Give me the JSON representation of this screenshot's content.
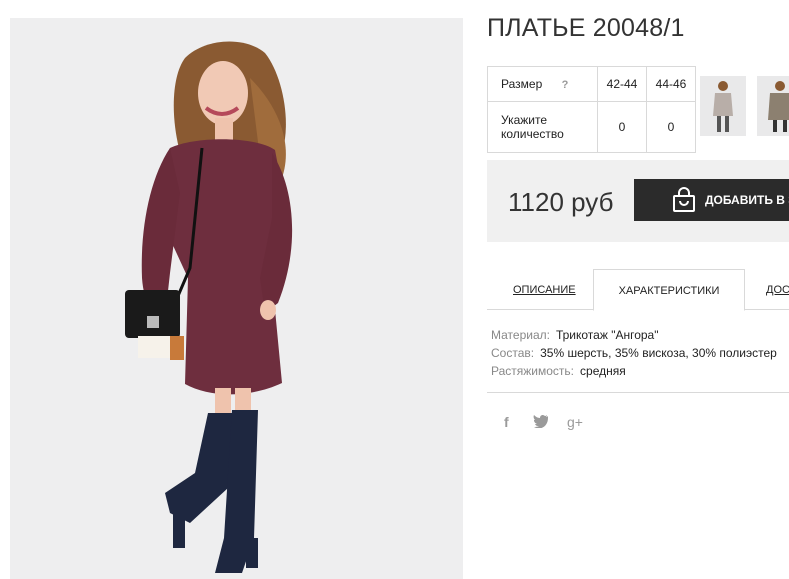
{
  "product": {
    "title": "ПЛАТЬЕ 20048/1"
  },
  "size_table": {
    "size_label": "Размер",
    "help_glyph": "?",
    "sizes": [
      "42-44",
      "44-46"
    ],
    "quantity_label": "Укажите количество",
    "quantities": [
      "0",
      "0"
    ]
  },
  "thumbnails": [
    {
      "icon": "dress-thumbnail",
      "dress_color": "#b8aea8"
    },
    {
      "icon": "dress-thumbnail",
      "dress_color": "#8c8070"
    }
  ],
  "purchase": {
    "price": "1120 руб",
    "add_button_label": "ДОБАВИТЬ В ЗАКАЗ",
    "button_color": "#2b2b2b"
  },
  "tabs": [
    {
      "label": "ОПИСАНИЕ",
      "active": false
    },
    {
      "label": "ХАРАКТЕРИСТИКИ",
      "active": true
    },
    {
      "label": "ДОСТАВКА",
      "active": false
    }
  ],
  "specs": [
    {
      "key": "Материал:",
      "value": "Трикотаж \"Ангора\""
    },
    {
      "key": "Состав:",
      "value": "35% шерсть, 35% вискоза, 30% полиэстер"
    },
    {
      "key": "Растяжимость:",
      "value": "средняя"
    }
  ],
  "social": [
    {
      "icon": "facebook-icon",
      "glyph": "f"
    },
    {
      "icon": "twitter-icon",
      "glyph": "🐦"
    },
    {
      "icon": "google-plus-icon",
      "glyph": "g+"
    }
  ],
  "colors": {
    "dress": "#6e2e3e",
    "boots": "#1e2740",
    "hair": "#8a5a32"
  }
}
